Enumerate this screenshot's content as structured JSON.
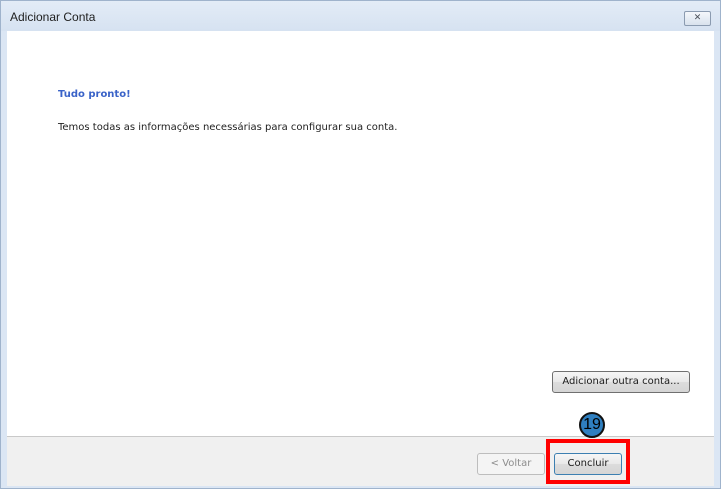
{
  "window": {
    "title": "Adicionar Conta",
    "close_glyph": "✕"
  },
  "content": {
    "heading": "Tudo pronto!",
    "message": "Temos todas as informações necessárias para configurar sua conta.",
    "add_account_label": "Adicionar outra conta..."
  },
  "footer": {
    "back_label": "< Voltar",
    "finish_label": "Concluir"
  },
  "annotation": {
    "step_number": "19",
    "highlight_color": "#ff0000",
    "badge_color": "#2f7fc0"
  },
  "colors": {
    "heading": "#3a63c8",
    "window_frame": "#dbe6f4"
  }
}
